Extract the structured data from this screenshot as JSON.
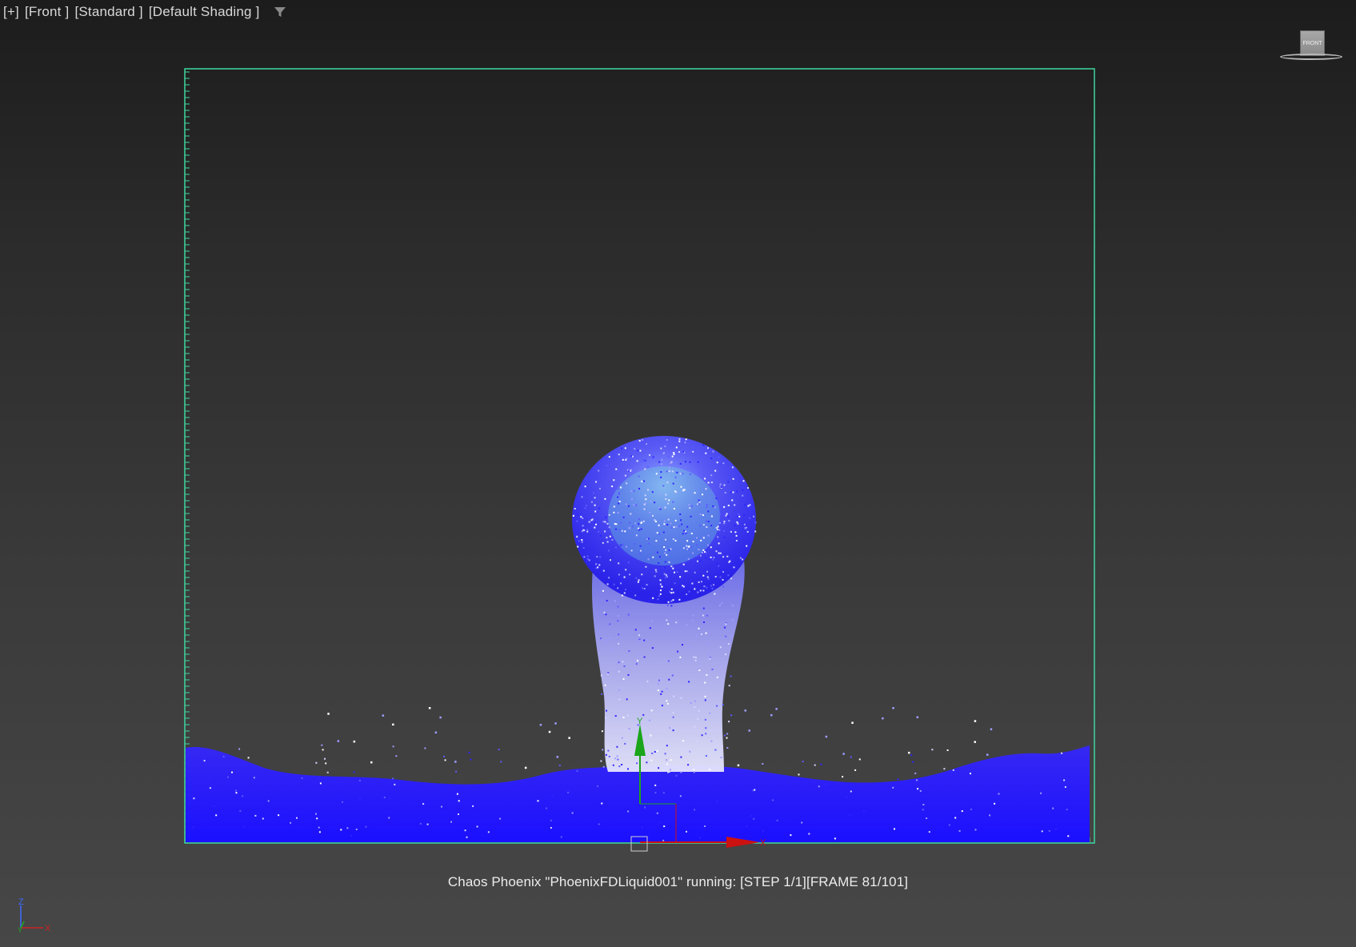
{
  "viewport": {
    "label_plus": "[+]",
    "label_view": "[Front ]",
    "label_mode": "[Standard ]",
    "label_shading": "[Default Shading ]",
    "filter_icon": "funnel-icon"
  },
  "viewcube": {
    "face_label": "FRONT"
  },
  "status": {
    "message": "Chaos Phoenix \"PhoenixFDLiquid001\" running: [STEP 1/1][FRAME 81/101]"
  },
  "axis_tripod": {
    "up": "Z",
    "right": "X",
    "depth": "Y"
  },
  "gizmo": {
    "y_label": "Y",
    "x_label": "X"
  },
  "colors": {
    "grid_green": "#3ed7a0",
    "liquid_blue": "#2a1fff",
    "liquid_light": "#c9c8ff",
    "axis_green": "#1aa51a",
    "axis_red": "#cc1111"
  }
}
